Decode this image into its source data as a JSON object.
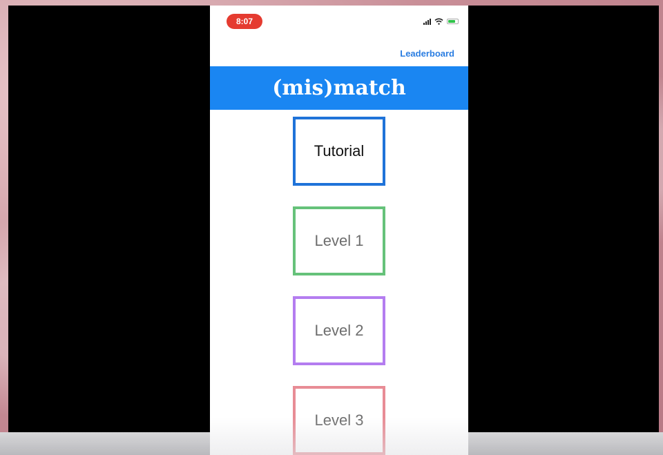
{
  "status_bar": {
    "time": "8:07",
    "icons": [
      "signal-icon",
      "wifi-icon",
      "battery-icon"
    ]
  },
  "header": {
    "leaderboard_label": "Leaderboard",
    "title": "(mis)match",
    "title_bar_color": "#1a86f2"
  },
  "levels": [
    {
      "label": "Tutorial",
      "border_color": "#1f73d9"
    },
    {
      "label": "Level 1",
      "border_color": "#66c27a"
    },
    {
      "label": "Level 2",
      "border_color": "#b47df0"
    },
    {
      "label": "Level 3",
      "border_color": "#e88c95"
    }
  ]
}
